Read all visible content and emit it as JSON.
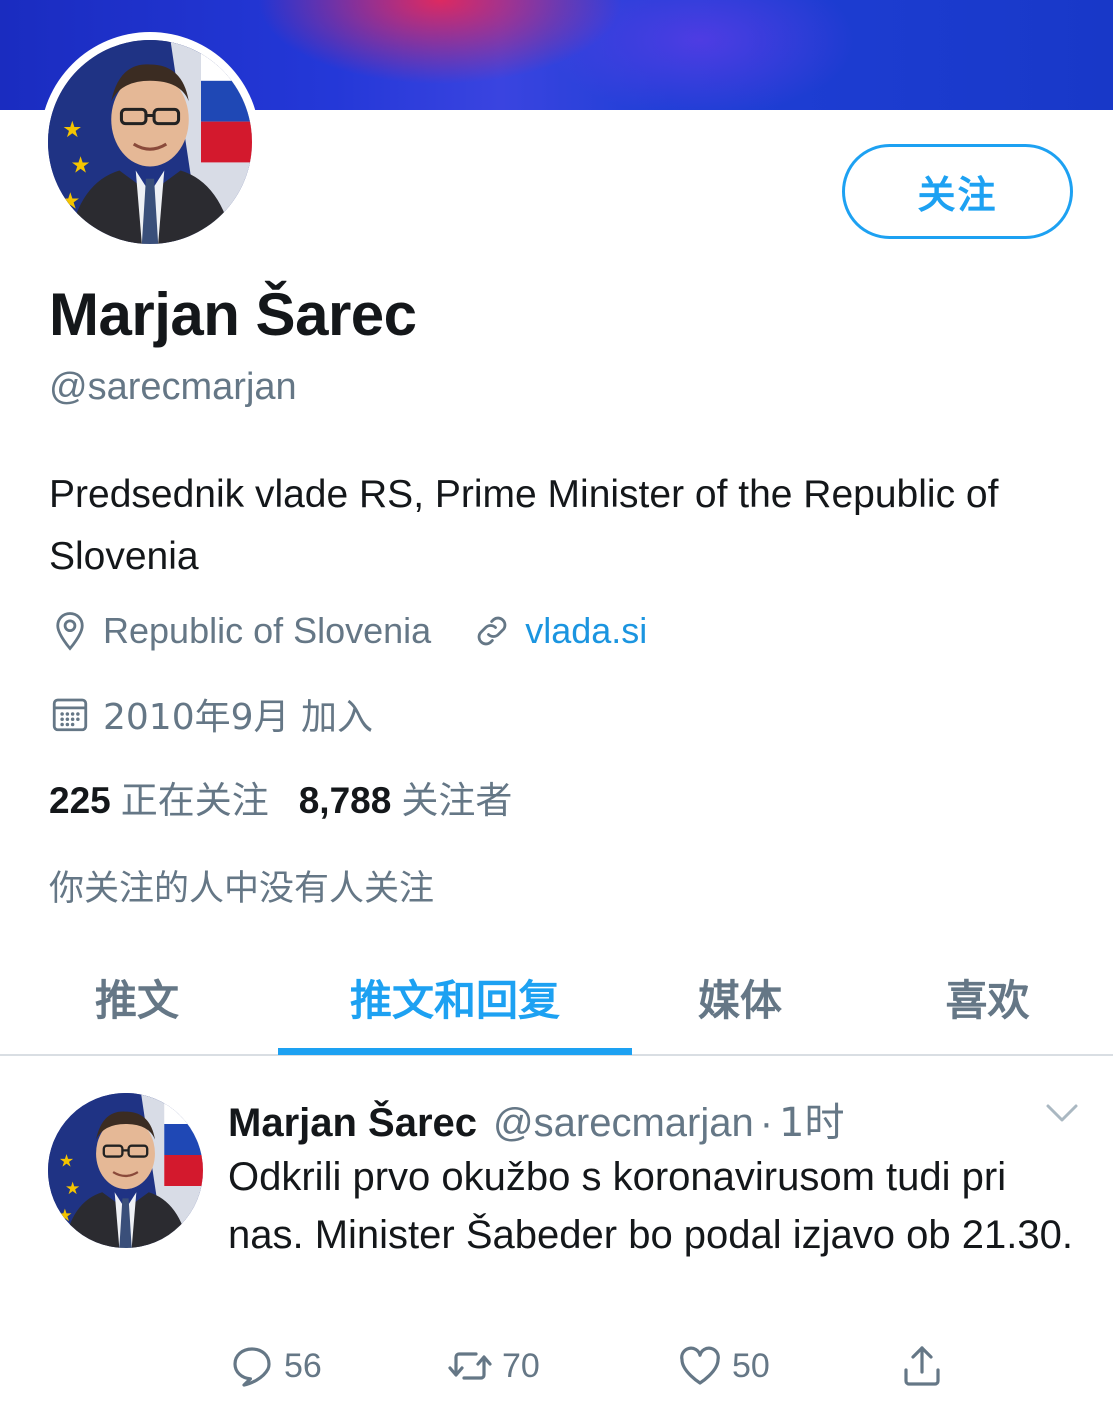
{
  "colors": {
    "accent": "#1da1f2",
    "link": "#1b95e0",
    "text_primary": "#14171a",
    "text_secondary": "#657786",
    "divider": "#d9dee3"
  },
  "profile": {
    "follow_button": "关注",
    "name": "Marjan Šarec",
    "handle": "@sarecmarjan",
    "bio": "Predsednik vlade RS, Prime Minister of the Republic of Slovenia",
    "location": "Republic of Slovenia",
    "website": "vlada.si",
    "joined": "2010年9月 加入",
    "following_count": "225",
    "following_label": "正在关注",
    "followers_count": "8,788",
    "followers_label": "关注者",
    "followers_you_know": "你关注的人中没有人关注"
  },
  "tabs": [
    {
      "label": "推文",
      "active": false
    },
    {
      "label": "推文和回复",
      "active": true
    },
    {
      "label": "媒体",
      "active": false
    },
    {
      "label": "喜欢",
      "active": false
    }
  ],
  "tweet": {
    "name": "Marjan Šarec",
    "handle": "@sarecmarjan",
    "separator": "·",
    "time": "1时",
    "text": "Odkrili prvo okužbo s koronavirusom tudi pri nas. Minister Šabeder bo podal izjavo ob 21.30.",
    "replies": "56",
    "retweets": "70",
    "likes": "50"
  },
  "icons": {
    "location": "location-pin-icon",
    "website": "link-icon",
    "joined": "calendar-icon",
    "more": "chevron-down-icon",
    "reply": "reply-icon",
    "retweet": "retweet-icon",
    "like": "heart-icon",
    "share": "share-icon"
  }
}
